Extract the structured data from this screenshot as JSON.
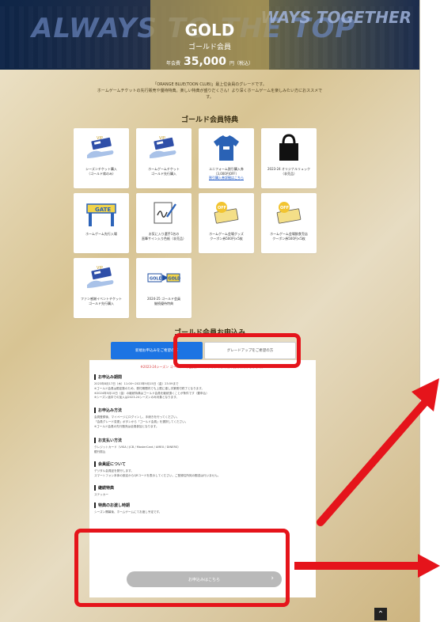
{
  "hero": {
    "slogan_left": "ALWAYS TO THE TOP",
    "slogan_right": "WAYS TOGETHER",
    "plan_title": "GOLD",
    "plan_subtitle": "ゴールド会員",
    "price_prefix": "年会費",
    "price": "35,000",
    "price_suffix": "円（税込）"
  },
  "intro": {
    "line1": "「ORANGE BLUE(TOON CLUB)」最上位会員のグレードです。",
    "line2": "ホームゲームチケットの先行販売や優待特典。楽しい特典が盛りだくさん！より深くホームゲームを楽しみたい方におススメです。"
  },
  "benefits": {
    "title": "ゴールド会員特典",
    "items": [
      {
        "icon": "ticket-hand-icon",
        "label": "シーズンチケット購入\n（ゴールド席のみ）",
        "link": ""
      },
      {
        "icon": "ticket-hand-icon",
        "label": "ホームゲームチケット\nゴールド先行購入",
        "link": ""
      },
      {
        "icon": "uniform-shirt-icon",
        "label": "ユニフォーム割引購入券\n（3,000円OFF）",
        "link": "割引購入券詳細はこちら"
      },
      {
        "icon": "tote-bag-icon",
        "label": "2023-24 オリジナルリュック\n（非売品）",
        "link": ""
      },
      {
        "icon": "gate-icon",
        "label": "ホームゲーム先行入場",
        "link": ""
      },
      {
        "icon": "signature-pen-icon",
        "label": "お気に入り選手1名の\n直筆サイン入り色紙（非売品）",
        "link": ""
      },
      {
        "icon": "off-coupon-icon",
        "label": "ホームゲーム会場グッズ\nクーポン券500円×5枚",
        "link": ""
      },
      {
        "icon": "off-coupon-icon",
        "label": "ホームゲーム会場飲食売店\nクーポン券500円×5枚",
        "link": ""
      },
      {
        "icon": "ticket-hand-icon",
        "label": "ファン感謝イベントチケット\nゴールド先行購入",
        "link": ""
      },
      {
        "icon": "gold-gold-icon",
        "label": "2024-25 ゴールド会員\n継続優待特典",
        "link": ""
      }
    ]
  },
  "apply": {
    "title": "ゴールド会員お申込み",
    "tab_new": "新規お申込みをご希望の方",
    "tab_upgrade": "グレードアップをご希望の方",
    "notice": "※2023-24シーズン ゴールドへの会員グレードアップのお申込み受付は終了しました。",
    "sections": [
      {
        "heading": "お申込み期間",
        "body": "2023年8月17日（木）11:00〜2023年9月15日（金）23:59まで\n※ゴールド会員は限定数のため、受付期間内でも上限に達し次第受付終了となります。\n※2024年5月10日（金）の継続特典はゴールド会員を継続頂くことが条件です（要申込）\n※シーズン途中での加入は2023-24シーズンのみ対象となります。"
      },
      {
        "heading": "お申込み方法",
        "body": "会員登録後、マイページにログインし、手続きを行ってください。\n「会員グレード変更」ボタンから「ゴールド会員」を選択してください。\n※ゴールド会員の先行販売は全員参加となります。"
      },
      {
        "heading": "お支払い方法",
        "body": "クレジットカード（VISA / JCB / MasterCard / AMEX / DINERS）\n銀行振込"
      },
      {
        "heading": "会員証について",
        "body": "デジタル会員証を発行します。\nスマートフォン本体の設定からQRコードを表示してください。ご登録住所宛の郵送は行いません。"
      },
      {
        "heading": "継続特典",
        "body": "ステッカー"
      },
      {
        "heading": "特典のお渡し時期",
        "body": "シーズン開幕後、ホームゲームにてお渡し予定です。"
      }
    ],
    "button": "お申込みはこちら",
    "button_chevron": "›"
  },
  "page_top_arrow": "⌃",
  "colors": {
    "highlight": "#e5141b",
    "tab_active": "#1c74e3",
    "gold_bg": "#d8c493"
  }
}
